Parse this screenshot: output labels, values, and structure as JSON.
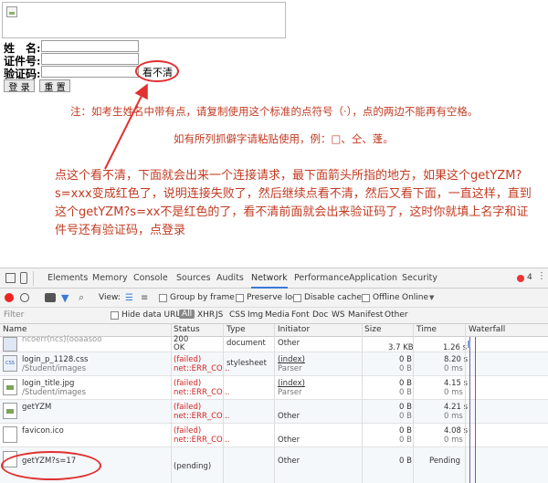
{
  "form": {
    "name_label": "姓　名:",
    "id_label": "证件号:",
    "captcha_label": "验证码:",
    "captcha_link": "看不清",
    "login_button": "登 录",
    "reset_button": "重 置"
  },
  "notes": {
    "space_note": "注：如考生姓名中带有点，请复制使用这个标准的点符号（·），点的两边不能再有空格。",
    "rare_char_note": "如有所列抓僻字请粘贴使用，例：□、仝、蓬。",
    "instruction": "点这个看不清，下面就会出来一个连接请求，最下面箭头所指的地方，如果这个getYZM?s=xxx变成红色了，说明连接失败了，然后继续点看不清，然后又看下面，一直这样，直到这个getYZM?s=xx不是红色的了，看不清前面就会出来验证码了，这时你就填上名字和证件号还有验证码，点登录"
  },
  "devtools": {
    "tabs": [
      "Elements",
      "Memory",
      "Console",
      "Sources",
      "Audits",
      "Network",
      "Performance",
      "Application",
      "Security"
    ],
    "active_tab": "Network",
    "error_count": "4",
    "toolbar": {
      "view_label": "View:",
      "group_by_frame": "Group by frame",
      "preserve_log": "Preserve log",
      "disable_cache": "Disable cache",
      "offline": "Offline",
      "online": "Online"
    },
    "filter": {
      "placeholder": "Filter",
      "hide_data_urls": "Hide data URLs",
      "types": [
        "All",
        "XHR",
        "JS",
        "CSS",
        "Img",
        "Media",
        "Font",
        "Doc",
        "WS",
        "Manifest",
        "Other"
      ]
    },
    "columns": {
      "name": "Name",
      "status": "Status",
      "type": "Type",
      "initiator": "Initiator",
      "size": "Size",
      "time": "Time",
      "waterfall": "Waterfall"
    },
    "rows": [
      {
        "name": "ncoerr(ncs)(ooaasoo",
        "path": "",
        "status": "200",
        "status2": "OK",
        "type": "document",
        "initiator": "Other",
        "initiator2": "",
        "size": "",
        "size2": "3.7 KB",
        "time": "",
        "time2": "1.26 s",
        "icon": "doc"
      },
      {
        "name": "login_p_1128.css",
        "path": "/Student/images",
        "status": "(failed)",
        "status2": "net::ERR_CO...",
        "type": "stylesheet",
        "initiator": "(index)",
        "initiator2": "Parser",
        "size": "0 B",
        "size2": "0 B",
        "time": "8.20 s",
        "time2": "0 ms",
        "icon": "css"
      },
      {
        "name": "login_title.jpg",
        "path": "/Student/images",
        "status": "(failed)",
        "status2": "net::ERR_CO...",
        "type": "",
        "initiator": "(index)",
        "initiator2": "Parser",
        "size": "0 B",
        "size2": "0 B",
        "time": "4.15 s",
        "time2": "0 ms",
        "icon": "img"
      },
      {
        "name": "getYZM",
        "path": "",
        "status": "(failed)",
        "status2": "net::ERR_CO...",
        "type": "",
        "initiator": "Other",
        "initiator2": "",
        "size": "0 B",
        "size2": "0 B",
        "time": "4.21 s",
        "time2": "0 ms",
        "icon": "img"
      },
      {
        "name": "favicon.ico",
        "path": "",
        "status": "(failed)",
        "status2": "net::ERR_CO...",
        "type": "",
        "initiator": "Other",
        "initiator2": "",
        "size": "0 B",
        "size2": "0 B",
        "time": "4.08 s",
        "time2": "0 ms",
        "icon": "blank"
      },
      {
        "name": "getYZM?s=17",
        "path": "",
        "status": "(pending)",
        "status2": "",
        "type": "",
        "initiator": "Other",
        "initiator2": "",
        "size": "0 B",
        "size2": "",
        "time": "Pending",
        "time2": "",
        "icon": "blank"
      }
    ]
  },
  "colors": {
    "annotation": "#e03030",
    "note_text": "#c23b22",
    "failed": "#cc2222",
    "active_tab": "#3879d9"
  }
}
